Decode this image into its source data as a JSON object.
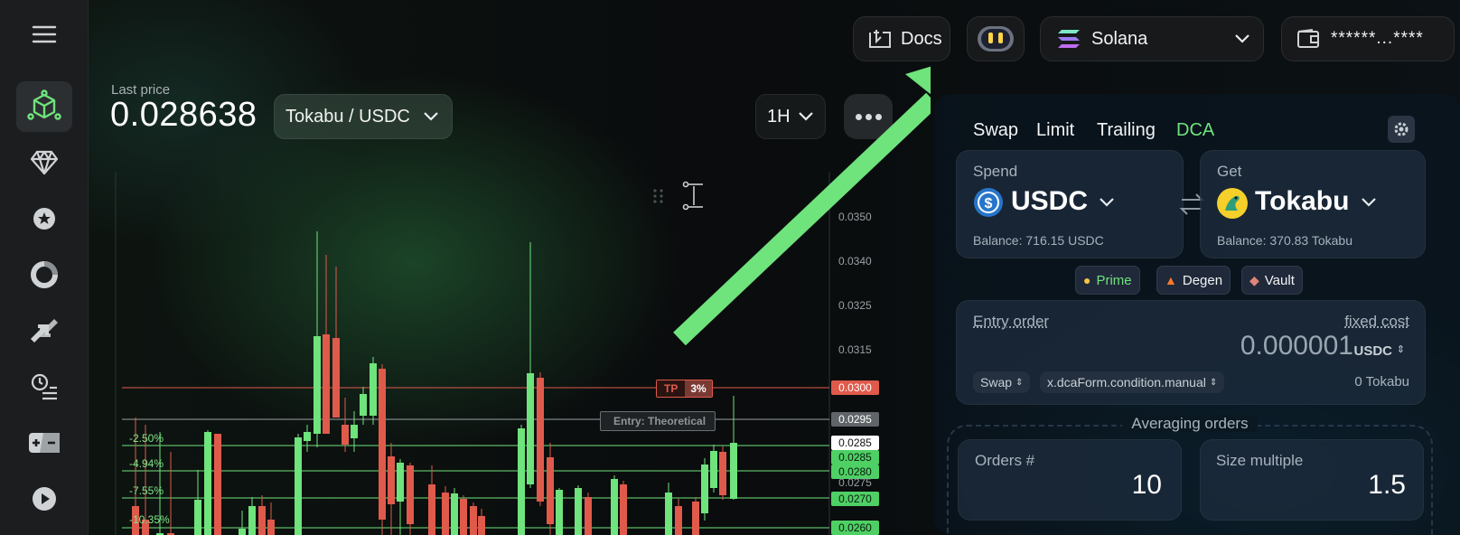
{
  "header": {
    "docs_label": "Docs",
    "network_label": "Solana",
    "wallet_label": "******...****"
  },
  "market": {
    "last_price_label": "Last price",
    "last_price": "0.028638",
    "pair_label": "Tokabu / USDC",
    "timeframe": "1H"
  },
  "chart": {
    "axis_ticks": [
      "0.0350",
      "0.0340",
      "0.0325",
      "0.0315"
    ],
    "price_tags": [
      {
        "value": "0.0300",
        "style": "tp"
      },
      {
        "value": "0.0295",
        "style": "entry"
      },
      {
        "value": "0.0285",
        "style": "white"
      },
      {
        "value": "0.0285",
        "style": "green"
      },
      {
        "value": "0.0280",
        "style": "green"
      },
      {
        "value": "0.0275",
        "style": "plain"
      },
      {
        "value": "0.0270",
        "style": "green"
      },
      {
        "value": "0.0260",
        "style": "green"
      }
    ],
    "tp_label": "TP",
    "tp_pct": "3%",
    "entry_label": "Entry: Theoretical",
    "level_pcts": [
      "-2.50%",
      "-4.94%",
      "-7.55%",
      "-10.35%"
    ]
  },
  "trade": {
    "tabs": [
      "Swap",
      "Limit",
      "Trailing",
      "DCA"
    ],
    "active_tab": "DCA",
    "spend": {
      "label": "Spend",
      "token": "USDC",
      "balance": "Balance: 716.15 USDC"
    },
    "get": {
      "label": "Get",
      "token": "Tokabu",
      "balance": "Balance: 370.83 Tokabu"
    },
    "modes": [
      "Prime",
      "Degen",
      "Vault"
    ],
    "entry_order": {
      "label": "Entry order",
      "cost_label": "fixed cost",
      "value": "0.000001",
      "unit": "USDC",
      "type_select": "Swap",
      "condition_select": "x.dcaForm.condition.manual",
      "amount": "0 Tokabu"
    },
    "averaging": {
      "title": "Averaging orders",
      "orders_label": "Orders #",
      "orders_value": "10",
      "size_label": "Size multiple",
      "size_value": "1.5"
    }
  },
  "colors": {
    "accent": "#6fe37c",
    "up": "#6fe37c",
    "down": "#e05a4b"
  }
}
